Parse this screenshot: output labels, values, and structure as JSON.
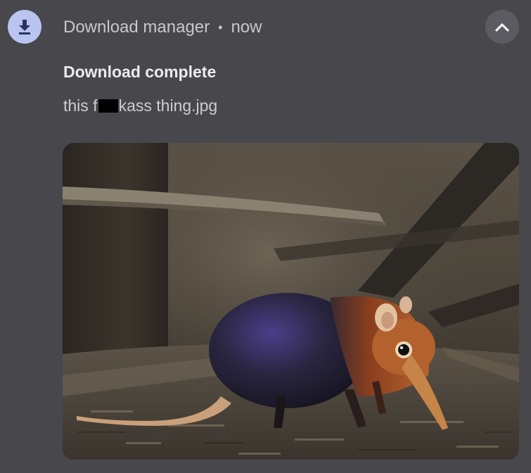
{
  "notification": {
    "app_icon": "download-icon",
    "app_name": "Download manager",
    "separator": "•",
    "timestamp": "now",
    "collapse_icon": "chevron-up-icon",
    "title": "Download complete",
    "filename_prefix": "this f",
    "filename_suffix": "kass thing.jpg",
    "colors": {
      "background": "#47474c",
      "icon_badge": "#b9c4f0",
      "icon_glyph": "#2b3460",
      "collapse_button": "#5b5b61"
    }
  }
}
